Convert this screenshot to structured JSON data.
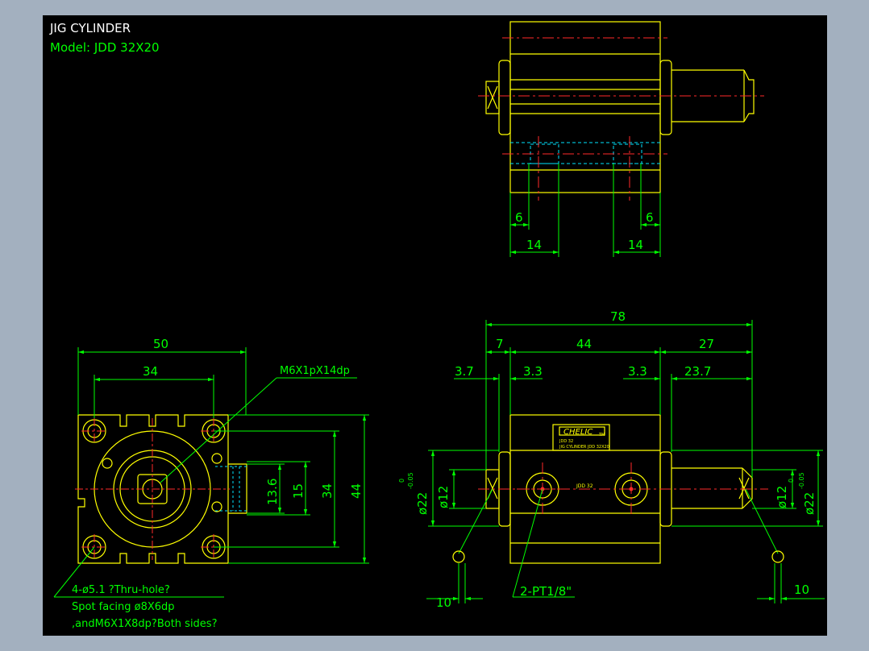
{
  "title": {
    "name": "JIG CYLINDER",
    "model": "Model:  JDD 32X20"
  },
  "colors": {
    "background": "#000000",
    "outline": "#ffff00",
    "dimension": "#00ff00",
    "centerline": "#ff2a2a",
    "hidden": "#00e5ff",
    "title": "#ffffff"
  },
  "top_view": {
    "dim_6_left": "6",
    "dim_6_right": "6",
    "dim_14_left": "14",
    "dim_14_right": "14"
  },
  "front_view": {
    "dim_78": "78",
    "dim_7": "7",
    "dim_44": "44",
    "dim_27": "27",
    "dim_3_7": "3.7",
    "dim_3_3a": "3.3",
    "dim_3_3b": "3.3",
    "dim_23_7": "23.7",
    "dia_12_left": "ø12",
    "dia_12_right": "ø12",
    "dia_22_left": "ø22",
    "tol_left_upper": "0",
    "tol_left_lower": "-0.05",
    "dia_22_right": "ø22",
    "tol_right_upper": "0",
    "tol_right_lower": "-0.05",
    "dim_10_left": "10",
    "dim_10_right": "10",
    "port_note": "2-PT1/8\"",
    "brand_label": "CHELIC",
    "brand_tm": "TM",
    "label_line1": "JDD 32",
    "label_line2": "JIG CYLINDER  JDD 32X20",
    "body_text": "JDD 32"
  },
  "side_view": {
    "dim_50": "50",
    "dim_34": "34",
    "dim_13_6": "13.6",
    "dim_15": "15",
    "dim_34_v": "34",
    "dim_44_v": "44",
    "thread_note": "M6X1pX14dp",
    "hole_note_1": "4-ø5.1 ?Thru-hole?",
    "hole_note_2": "Spot facing ø8X6dp",
    "hole_note_3": ",andM6X1X8dp?Both sides?"
  }
}
